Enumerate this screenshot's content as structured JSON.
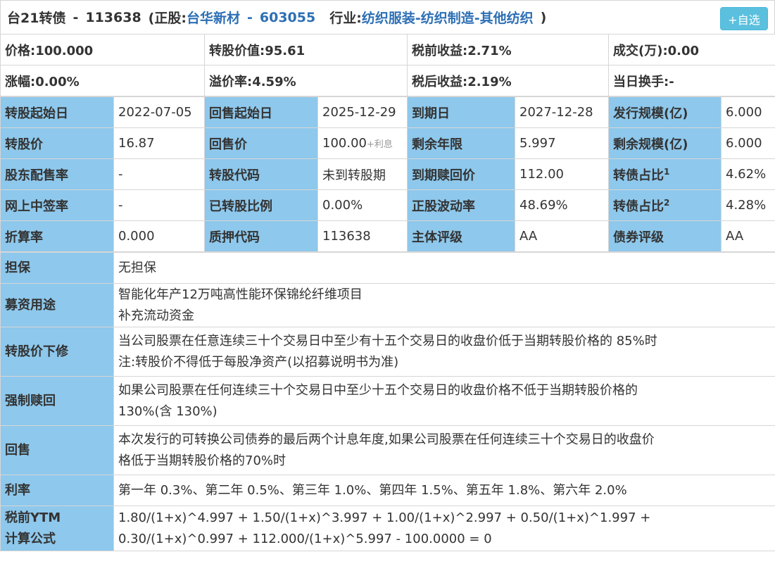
{
  "header": {
    "bond_name": "台21转债",
    "dash1": "-",
    "bond_code": "113638",
    "stock_prefix": "(正股:",
    "stock_name": "台华新材",
    "dash2": "-",
    "stock_code": "603055",
    "industry_prefix": "行业:",
    "industry": "纺织服装-纺织制造-其他纺织",
    "close_paren": ")",
    "add_button": "+自选"
  },
  "summary": {
    "row1": [
      "价格:100.000",
      "转股价值:95.61",
      "税前收益:2.71%",
      "成交(万):0.00"
    ],
    "row2": [
      "涨幅:0.00%",
      "溢价率:4.59%",
      "税后收益:2.19%",
      "当日换手:-"
    ]
  },
  "grid": [
    [
      {
        "l": "转股起始日"
      },
      {
        "v": "2022-07-05"
      },
      {
        "l": "回售起始日"
      },
      {
        "v": "2025-12-29"
      },
      {
        "l": "到期日"
      },
      {
        "v": "2027-12-28"
      },
      {
        "l": "发行规模(亿)"
      },
      {
        "v": "6.000"
      }
    ],
    [
      {
        "l": "转股价"
      },
      {
        "v": "16.87"
      },
      {
        "l": "回售价"
      },
      {
        "v": "100.00",
        "extra": "+利息"
      },
      {
        "l": "剩余年限"
      },
      {
        "v": "5.997"
      },
      {
        "l": "剩余规模(亿)"
      },
      {
        "v": "6.000"
      }
    ],
    [
      {
        "l": "股东配售率"
      },
      {
        "v": "-"
      },
      {
        "l": "转股代码"
      },
      {
        "v": "未到转股期",
        "red": true
      },
      {
        "l": "到期赎回价"
      },
      {
        "v": "112.00"
      },
      {
        "l": "转债占比",
        "sup": "1"
      },
      {
        "v": "4.62%"
      }
    ],
    [
      {
        "l": "网上中签率"
      },
      {
        "v": "-"
      },
      {
        "l": "已转股比例"
      },
      {
        "v": "0.00%"
      },
      {
        "l": "正股波动率"
      },
      {
        "v": "48.69%"
      },
      {
        "l": "转债占比",
        "sup": "2"
      },
      {
        "v": "4.28%"
      }
    ],
    [
      {
        "l": "折算率"
      },
      {
        "v": "0.000"
      },
      {
        "l": "质押代码"
      },
      {
        "v": "113638"
      },
      {
        "l": "主体评级"
      },
      {
        "v": "AA"
      },
      {
        "l": "债券评级"
      },
      {
        "v": "AA"
      }
    ]
  ],
  "details": [
    {
      "label": "担保",
      "lines": [
        "无担保"
      ]
    },
    {
      "label": "募资用途",
      "lines": [
        "智能化年产12万吨高性能环保锦纶纤维项目",
        "补充流动资金"
      ]
    },
    {
      "label": "转股价下修",
      "lines": [
        "当公司股票在任意连续三十个交易日中至少有十五个交易日的收盘价低于当期转股价格的 85%时",
        "注:转股价不得低于每股净资产(以招募说明书为准)"
      ]
    },
    {
      "label": "强制赎回",
      "lines": [
        "如果公司股票在任何连续三十个交易日中至少十五个交易日的收盘价格不低于当期转股价格的",
        "130%(含 130%)"
      ]
    },
    {
      "label": "回售",
      "lines": [
        "本次发行的可转换公司债券的最后两个计息年度,如果公司股票在任何连续三十个交易日的收盘价",
        "格低于当期转股价格的70%时"
      ]
    },
    {
      "label": "利率",
      "lines": [
        "第一年 0.3%、第二年 0.5%、第三年 1.0%、第四年 1.5%、第五年 1.8%、第六年 2.0%"
      ]
    },
    {
      "label_lines": [
        "税前YTM",
        "计算公式"
      ],
      "lines": [
        "1.80/(1+x)^4.997 + 1.50/(1+x)^3.997 + 1.00/(1+x)^2.997 + 0.50/(1+x)^1.997 +",
        "0.30/(1+x)^0.997 + 112.000/(1+x)^5.997 - 100.0000 = 0"
      ]
    }
  ]
}
